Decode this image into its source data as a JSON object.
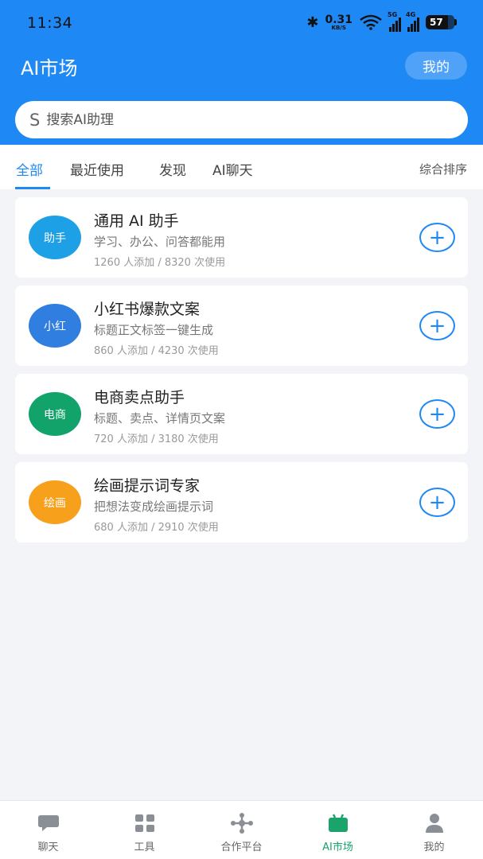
{
  "status_bar": {
    "time": "11:34",
    "speed_value": "0.31",
    "speed_unit": "KB/S",
    "net_a": "5G",
    "net_b": "4G",
    "battery": "57"
  },
  "header": {
    "title": "AI市场",
    "me_label": "我的"
  },
  "search": {
    "icon_glyph": "S",
    "placeholder": "搜索AI助理"
  },
  "tabs": [
    {
      "label": "全部"
    },
    {
      "label": "最近使用"
    },
    {
      "label": "发现"
    },
    {
      "label": "AI聊天"
    }
  ],
  "sort_label": "综合排序",
  "assistants": [
    {
      "avatar": "助手",
      "avatar_color": "#1ea0e6",
      "title": "通用 AI 助手",
      "desc": "学习、办公、问答都能用",
      "stats": "1260 人添加 / 8320 次使用"
    },
    {
      "avatar": "小红",
      "avatar_color": "#2f7ee0",
      "title": "小红书爆款文案",
      "desc": "标题正文标签一键生成",
      "stats": "860 人添加 / 4230 次使用"
    },
    {
      "avatar": "电商",
      "avatar_color": "#11a36a",
      "title": "电商卖点助手",
      "desc": "标题、卖点、详情页文案",
      "stats": "720 人添加 / 3180 次使用"
    },
    {
      "avatar": "绘画",
      "avatar_color": "#f6a01c",
      "title": "绘画提示词专家",
      "desc": "把想法变成绘画提示词",
      "stats": "680 人添加 / 2910 次使用"
    }
  ],
  "bottom_nav": [
    {
      "label": "聊天",
      "icon": "chat-bubble-icon"
    },
    {
      "label": "工具",
      "icon": "grid-icon"
    },
    {
      "label": "合作平台",
      "icon": "network-icon"
    },
    {
      "label": "AI市场",
      "icon": "market-icon",
      "active": true
    },
    {
      "label": "我的",
      "icon": "person-icon"
    }
  ],
  "colors": {
    "primary": "#1e88f5",
    "active_nav": "#1aa36b",
    "background": "#f2f4f7"
  }
}
